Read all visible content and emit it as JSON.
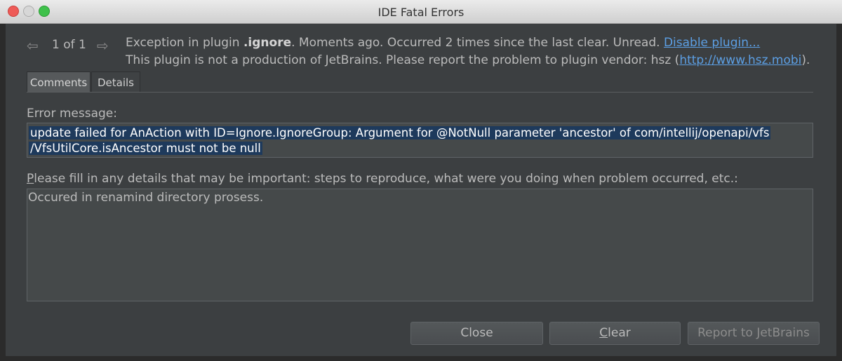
{
  "window": {
    "title": "IDE Fatal Errors"
  },
  "nav": {
    "prev_arrow": "⇦",
    "counter": "1 of 1",
    "next_arrow": "⇨"
  },
  "info": {
    "line1_prefix": "Exception in plugin ",
    "plugin_name": ".ignore",
    "line1_suffix": ". Moments ago. Occurred 2 times since the last clear. Unread. ",
    "disable_link": "Disable plugin...",
    "line2_prefix": "This plugin is not a production of JetBrains. Please report the problem to plugin vendor: hsz (",
    "vendor_link": "http://www.hsz.mobi",
    "line2_suffix": ")."
  },
  "tabs": [
    {
      "label": "Comments",
      "active": true
    },
    {
      "label": "Details",
      "active": false
    }
  ],
  "error": {
    "label": "Error message:",
    "line1": "update failed for AnAction with ID=Ignore.IgnoreGroup: Argument for @NotNull parameter 'ancestor' of com/intellij/openapi/vfs",
    "line2": "/VfsUtilCore.isAncestor must not be null"
  },
  "details": {
    "label_first": "P",
    "label_rest": "lease fill in any details that may be important: steps to reproduce, what were you doing when problem occurred, etc.:",
    "value": "Occured in renamind directory prosess."
  },
  "buttons": {
    "close": "Close",
    "clear_first": "C",
    "clear_rest": "lear",
    "report": "Report to JetBrains"
  }
}
